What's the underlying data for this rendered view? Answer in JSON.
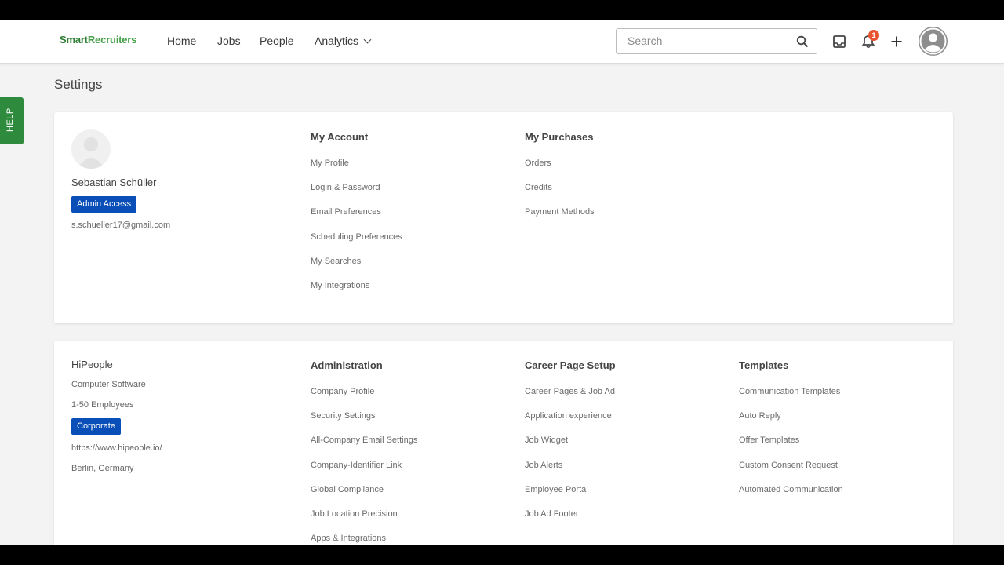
{
  "topbar": {
    "logo_a": "Smart",
    "logo_b": "Recruiters",
    "nav": [
      "Home",
      "Jobs",
      "People",
      "Analytics"
    ],
    "search_placeholder": "Search",
    "notification_count": "1"
  },
  "help_label": "HELP",
  "page_title": "Settings",
  "profile": {
    "name": "Sebastian Schüller",
    "access_badge": "Admin Access",
    "email": "s.schueller17@gmail.com"
  },
  "my_account": {
    "title": "My Account",
    "links": [
      "My Profile",
      "Login & Password",
      "Email Preferences",
      "Scheduling Preferences",
      "My Searches",
      "My Integrations"
    ]
  },
  "my_purchases": {
    "title": "My Purchases",
    "links": [
      "Orders",
      "Credits",
      "Payment Methods"
    ]
  },
  "company": {
    "name": "HiPeople",
    "industry": "Computer Software",
    "size": "1-50 Employees",
    "plan_badge": "Corporate",
    "website": "https://www.hipeople.io/",
    "location": "Berlin, Germany"
  },
  "administration": {
    "title": "Administration",
    "links": [
      "Company Profile",
      "Security Settings",
      "All-Company Email Settings",
      "Company-Identifier Link",
      "Global Compliance",
      "Job Location Precision",
      "Apps & Integrations"
    ]
  },
  "career_page": {
    "title": "Career Page Setup",
    "links": [
      "Career Pages & Job Ad",
      "Application experience",
      "Job Widget",
      "Job Alerts",
      "Employee Portal",
      "Job Ad Footer"
    ]
  },
  "templates": {
    "title": "Templates",
    "links": [
      "Communication Templates",
      "Auto Reply",
      "Offer Templates",
      "Custom Consent Request",
      "Automated Communication"
    ]
  },
  "colors": {
    "brand_green": "#2e7d32",
    "badge_blue": "#0a4fb8",
    "help_green": "#2e8b3e",
    "notification_red": "#e8542f"
  }
}
